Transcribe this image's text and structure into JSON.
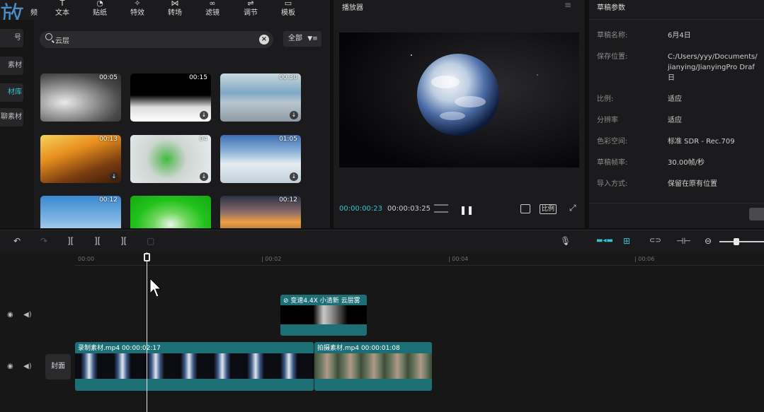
{
  "toolbar": {
    "items": [
      {
        "label": "频",
        "icon": "media-icon"
      },
      {
        "label": "文本",
        "icon": "text-icon"
      },
      {
        "label": "贴纸",
        "icon": "sticker-icon"
      },
      {
        "label": "特效",
        "icon": "effects-icon"
      },
      {
        "label": "转场",
        "icon": "transition-icon"
      },
      {
        "label": "滤镜",
        "icon": "filter-icon"
      },
      {
        "label": "调节",
        "icon": "adjust-icon"
      },
      {
        "label": "模板",
        "icon": "template-icon"
      }
    ],
    "big_char": "放"
  },
  "left_nav": {
    "items": [
      {
        "label": "号"
      },
      {
        "label": "素材"
      },
      {
        "label": "材库",
        "active": true
      },
      {
        "label": "聊素材"
      }
    ]
  },
  "library": {
    "search_value": "云层",
    "filter_label": "全部",
    "thumbnails": [
      {
        "duration": "00:05",
        "download": false,
        "style": "clouds-gray"
      },
      {
        "duration": "00:15",
        "download": true,
        "style": "clouds-black"
      },
      {
        "duration": "00:30",
        "download": true,
        "style": "sky-horizon"
      },
      {
        "duration": "00:13",
        "download": true,
        "style": "sunset-orange"
      },
      {
        "duration": "04",
        "download": true,
        "style": "green-clouds"
      },
      {
        "duration": "01:05",
        "download": true,
        "style": "sea-of-clouds"
      },
      {
        "duration": "00:12",
        "download": false,
        "style": "blue-sky"
      },
      {
        "duration": "",
        "download": false,
        "style": "green-screen"
      },
      {
        "duration": "00:12",
        "download": false,
        "style": "sunset-horizon"
      }
    ]
  },
  "player": {
    "title": "播放器",
    "current_time": "00:00:00:23",
    "total_time": "00:00:03:25",
    "ratio_label": "比例"
  },
  "params": {
    "title": "草稿参数",
    "rows": [
      {
        "key": "草稿名称:",
        "value": "6月4日"
      },
      {
        "key": "保存位置:",
        "value": "C:/Users/yyy/Documents/\njianying/JianyingPro Draf\n日"
      },
      {
        "key": "比例:",
        "value": "适应"
      },
      {
        "key": "分辨率",
        "value": "适应"
      },
      {
        "key": "色彩空间:",
        "value": "标准 SDR - Rec.709"
      },
      {
        "key": "草稿帧率:",
        "value": "30.00帧/秒"
      },
      {
        "key": "导入方式:",
        "value": "保留在原有位置"
      }
    ]
  },
  "timeline": {
    "ruler": [
      "00:00",
      "| 00:02",
      "| 00:04",
      "| 00:06"
    ],
    "cover_label": "封面",
    "overlay_clip": {
      "speed": "变速4.4X",
      "name": "小清新 云层雾"
    },
    "main_clips": [
      {
        "name": "录制素材.mp4",
        "duration": "00:00:02:17"
      },
      {
        "name": "拍摄素材.mp4",
        "duration": "00:00:01:08"
      }
    ]
  },
  "colors": {
    "accent": "#35c2d6",
    "teal_clip": "#1d6f76",
    "panel": "#1b1b1d"
  }
}
